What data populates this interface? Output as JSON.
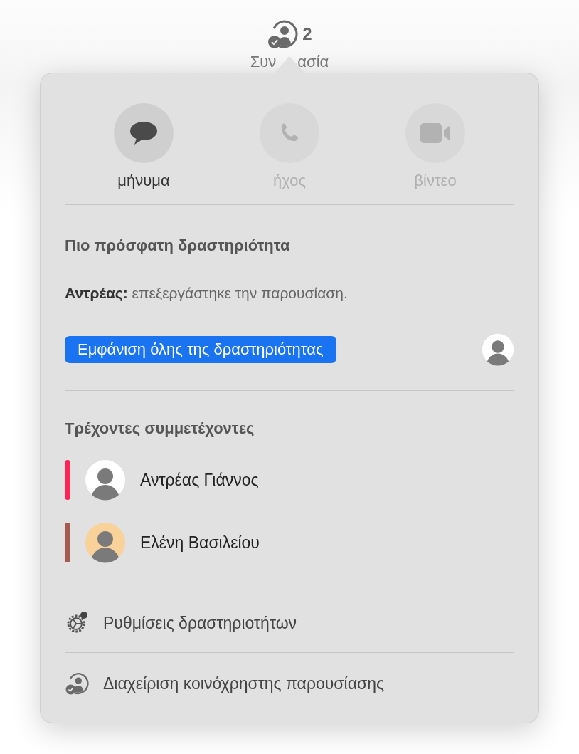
{
  "toolbar_button": {
    "count": "2",
    "label_before_arrow": "Συν",
    "label_after_arrow": "ασία"
  },
  "popover": {
    "actions": [
      {
        "kind": "message",
        "label": "μήνυμα",
        "disabled": false
      },
      {
        "kind": "audio",
        "label": "ήχος",
        "disabled": true
      },
      {
        "kind": "video",
        "label": "βίντεο",
        "disabled": true
      }
    ],
    "recent_activity": {
      "heading": "Πιο πρόσφατη δραστηριότητα",
      "text": "**Αντρέας:** επεξεργάστηκε την παρουσίαση.",
      "button": "Εμφάνιση όλης της δραστηριότητας"
    },
    "participants": {
      "heading": "Τρέχοντες συμμετέχοντες",
      "items": [
        {
          "name": "Αντρέας Γιάννος",
          "color": "#ff2358"
        },
        {
          "name": "Ελένη Βασιλείου",
          "color": "#a85a4e"
        }
      ]
    },
    "menu": [
      {
        "kind": "settings",
        "label": "Ρυθμίσεις δραστηριοτήτων"
      },
      {
        "kind": "manage",
        "label": "Διαχείριση κοινόχρηστης παρουσίασης"
      }
    ]
  }
}
